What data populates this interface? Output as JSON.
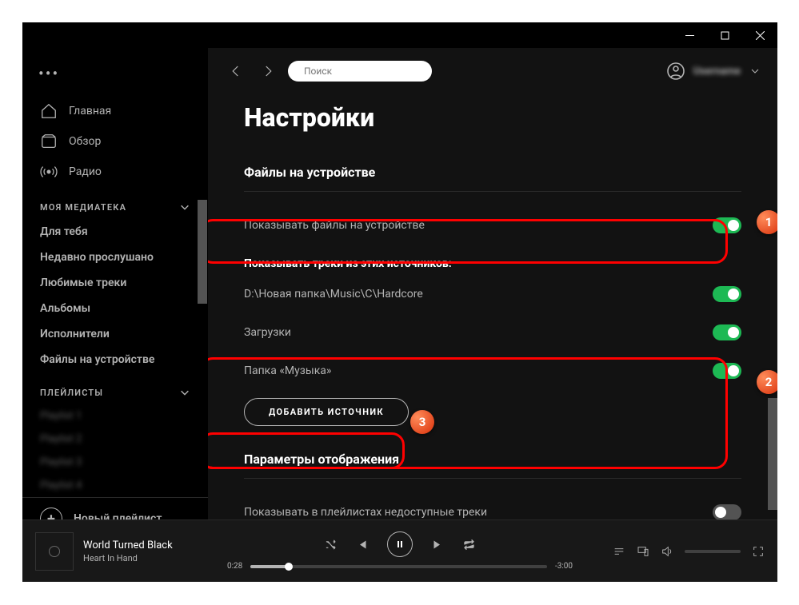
{
  "search": {
    "placeholder": "Поиск"
  },
  "user": {
    "name": "Username"
  },
  "sidebar": {
    "nav": [
      {
        "label": "Главная"
      },
      {
        "label": "Обзор"
      },
      {
        "label": "Радио"
      }
    ],
    "library_header": "МОЯ МЕДИАТЕКА",
    "library": [
      "Для тебя",
      "Недавно прослушано",
      "Любимые треки",
      "Альбомы",
      "Исполнители",
      "Файлы на устройстве"
    ],
    "playlists_header": "ПЛЕЙЛИСТЫ",
    "playlists": [
      "Playlist 1",
      "Playlist 2",
      "Playlist 3",
      "Playlist 4"
    ],
    "new_playlist": "Новый плейлист"
  },
  "settings": {
    "title": "Настройки",
    "section_local": "Файлы на устройстве",
    "show_local": "Показывать файлы на устройстве",
    "show_sources_label": "Показывать треки из этих источников:",
    "sources": [
      {
        "path": "D:\\Новая папка\\Music\\C\\Hardcore",
        "on": true
      },
      {
        "path": "Загрузки",
        "on": true
      },
      {
        "path": "Папка «Музыка»",
        "on": true
      }
    ],
    "add_source": "ДОБАВИТЬ ИСТОЧНИК",
    "section_display": "Параметры отображения",
    "show_unavailable": "Показывать в плейлистах недоступные треки"
  },
  "player": {
    "track": "World Turned Black",
    "artist": "Heart In Hand",
    "elapsed": "0:28",
    "remaining": "-3:00"
  },
  "callouts": {
    "c1": "1",
    "c2": "2",
    "c3": "3"
  }
}
